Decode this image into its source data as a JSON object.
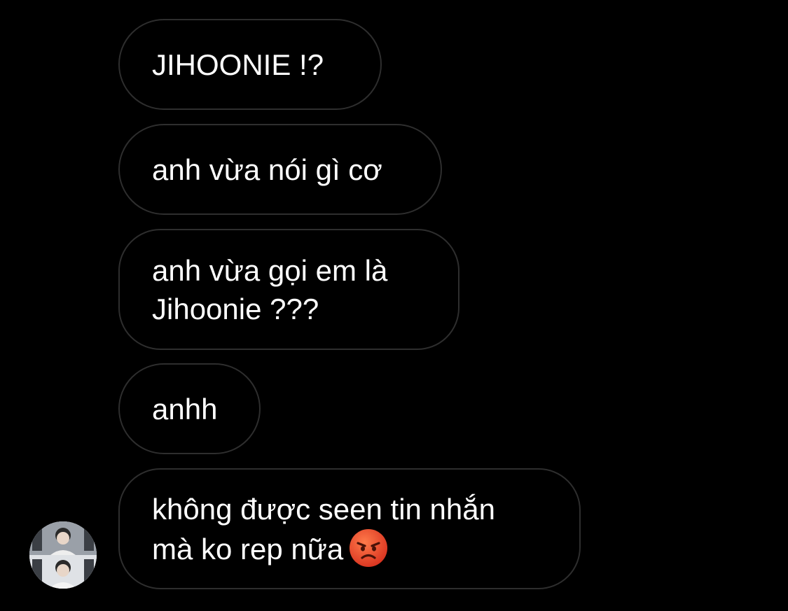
{
  "messages": [
    {
      "text": "JIHOONIE !?"
    },
    {
      "text": "anh vừa nói gì cơ"
    },
    {
      "lines": [
        "anh vừa gọi em là",
        "Jihoonie ???"
      ]
    },
    {
      "text": "anhh"
    },
    {
      "lines": [
        "không được seen tin nhắn",
        "mà ko rep nữa"
      ],
      "emoji": "angry-face"
    }
  ],
  "avatar": {
    "icon": "profile-photo"
  },
  "colors": {
    "background": "#000000",
    "bubble_border": "#2e2e2e",
    "text": "#ffffff",
    "emoji_face": "#e8452c"
  }
}
